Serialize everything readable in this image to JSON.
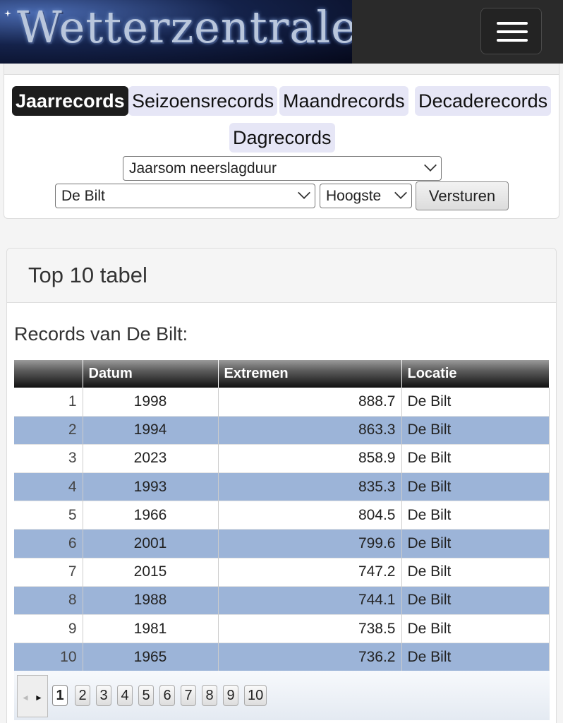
{
  "header": {
    "logo_text": "Wetterzentrale",
    "menu_icon": "hamburger-icon"
  },
  "record_tabs": [
    {
      "label": "Jaarrecords",
      "active": true
    },
    {
      "label": "Seizoensrecords",
      "active": false
    },
    {
      "label": "Maandrecords",
      "active": false
    },
    {
      "label": "Decaderecords",
      "active": false
    },
    {
      "label": "Dagrecords",
      "active": false
    }
  ],
  "form": {
    "parameter_value": "Jaarsom neerslagduur",
    "station_value": "De Bilt",
    "order_value": "Hoogste",
    "submit_label": "Versturen"
  },
  "card": {
    "title": "Top 10 tabel",
    "records_title": "Records van De Bilt:"
  },
  "table": {
    "headers": [
      "",
      "Datum",
      "Extremen",
      "Locatie"
    ],
    "rows": [
      {
        "rank": "1",
        "date": "1998",
        "value": "888.7",
        "location": "De Bilt"
      },
      {
        "rank": "2",
        "date": "1994",
        "value": "863.3",
        "location": "De Bilt"
      },
      {
        "rank": "3",
        "date": "2023",
        "value": "858.9",
        "location": "De Bilt"
      },
      {
        "rank": "4",
        "date": "1993",
        "value": "835.3",
        "location": "De Bilt"
      },
      {
        "rank": "5",
        "date": "1966",
        "value": "804.5",
        "location": "De Bilt"
      },
      {
        "rank": "6",
        "date": "2001",
        "value": "799.6",
        "location": "De Bilt"
      },
      {
        "rank": "7",
        "date": "2015",
        "value": "747.2",
        "location": "De Bilt"
      },
      {
        "rank": "8",
        "date": "1988",
        "value": "744.1",
        "location": "De Bilt"
      },
      {
        "rank": "9",
        "date": "1981",
        "value": "738.5",
        "location": "De Bilt"
      },
      {
        "rank": "10",
        "date": "1965",
        "value": "736.2",
        "location": "De Bilt"
      }
    ]
  },
  "pagination": {
    "prev_icon": "arrow-left-icon",
    "next_icon": "arrow-right-icon",
    "pages": [
      "1",
      "2",
      "3",
      "4",
      "5",
      "6",
      "7",
      "8",
      "9",
      "10"
    ],
    "current": "1"
  },
  "colors": {
    "alt_row": "#9cb4d8",
    "tab_active": "#1d1d1d",
    "tab_inactive": "#e6e6f6"
  }
}
